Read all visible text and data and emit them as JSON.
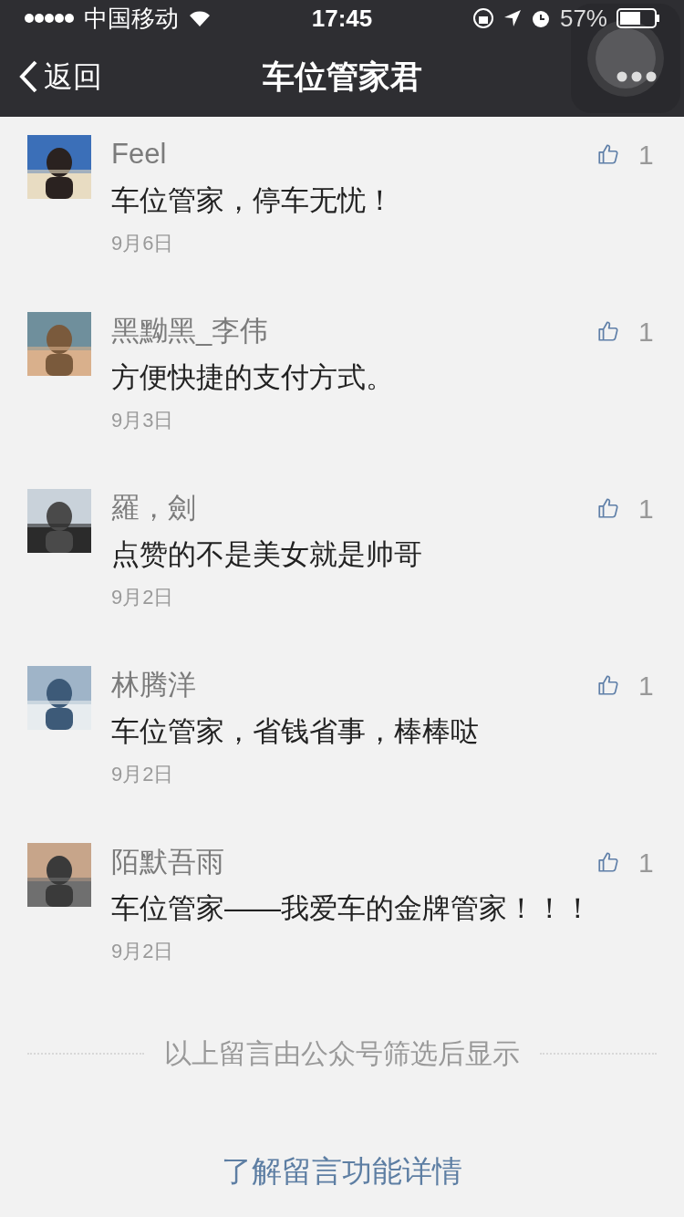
{
  "status_bar": {
    "carrier": "中国移动",
    "time": "17:45",
    "battery": "57%"
  },
  "nav": {
    "back": "返回",
    "title": "车位管家君"
  },
  "comments": [
    {
      "name": "Feel",
      "text": "车位管家，停车无忧！",
      "date": "9月6日",
      "likes": "1"
    },
    {
      "name": "黑黝黑_李伟",
      "text": "方便快捷的支付方式。",
      "date": "9月3日",
      "likes": "1"
    },
    {
      "name": "羅，劍",
      "text": "点赞的不是美女就是帅哥",
      "date": "9月2日",
      "likes": "1"
    },
    {
      "name": "林腾洋",
      "text": "车位管家，省钱省事，棒棒哒",
      "date": "9月2日",
      "likes": "1"
    },
    {
      "name": "陌默吾雨",
      "text": "车位管家——我爱车的金牌管家！！！",
      "date": "9月2日",
      "likes": "1"
    }
  ],
  "footer": {
    "note": "以上留言由公众号筛选后显示",
    "link": "了解留言功能详情"
  }
}
